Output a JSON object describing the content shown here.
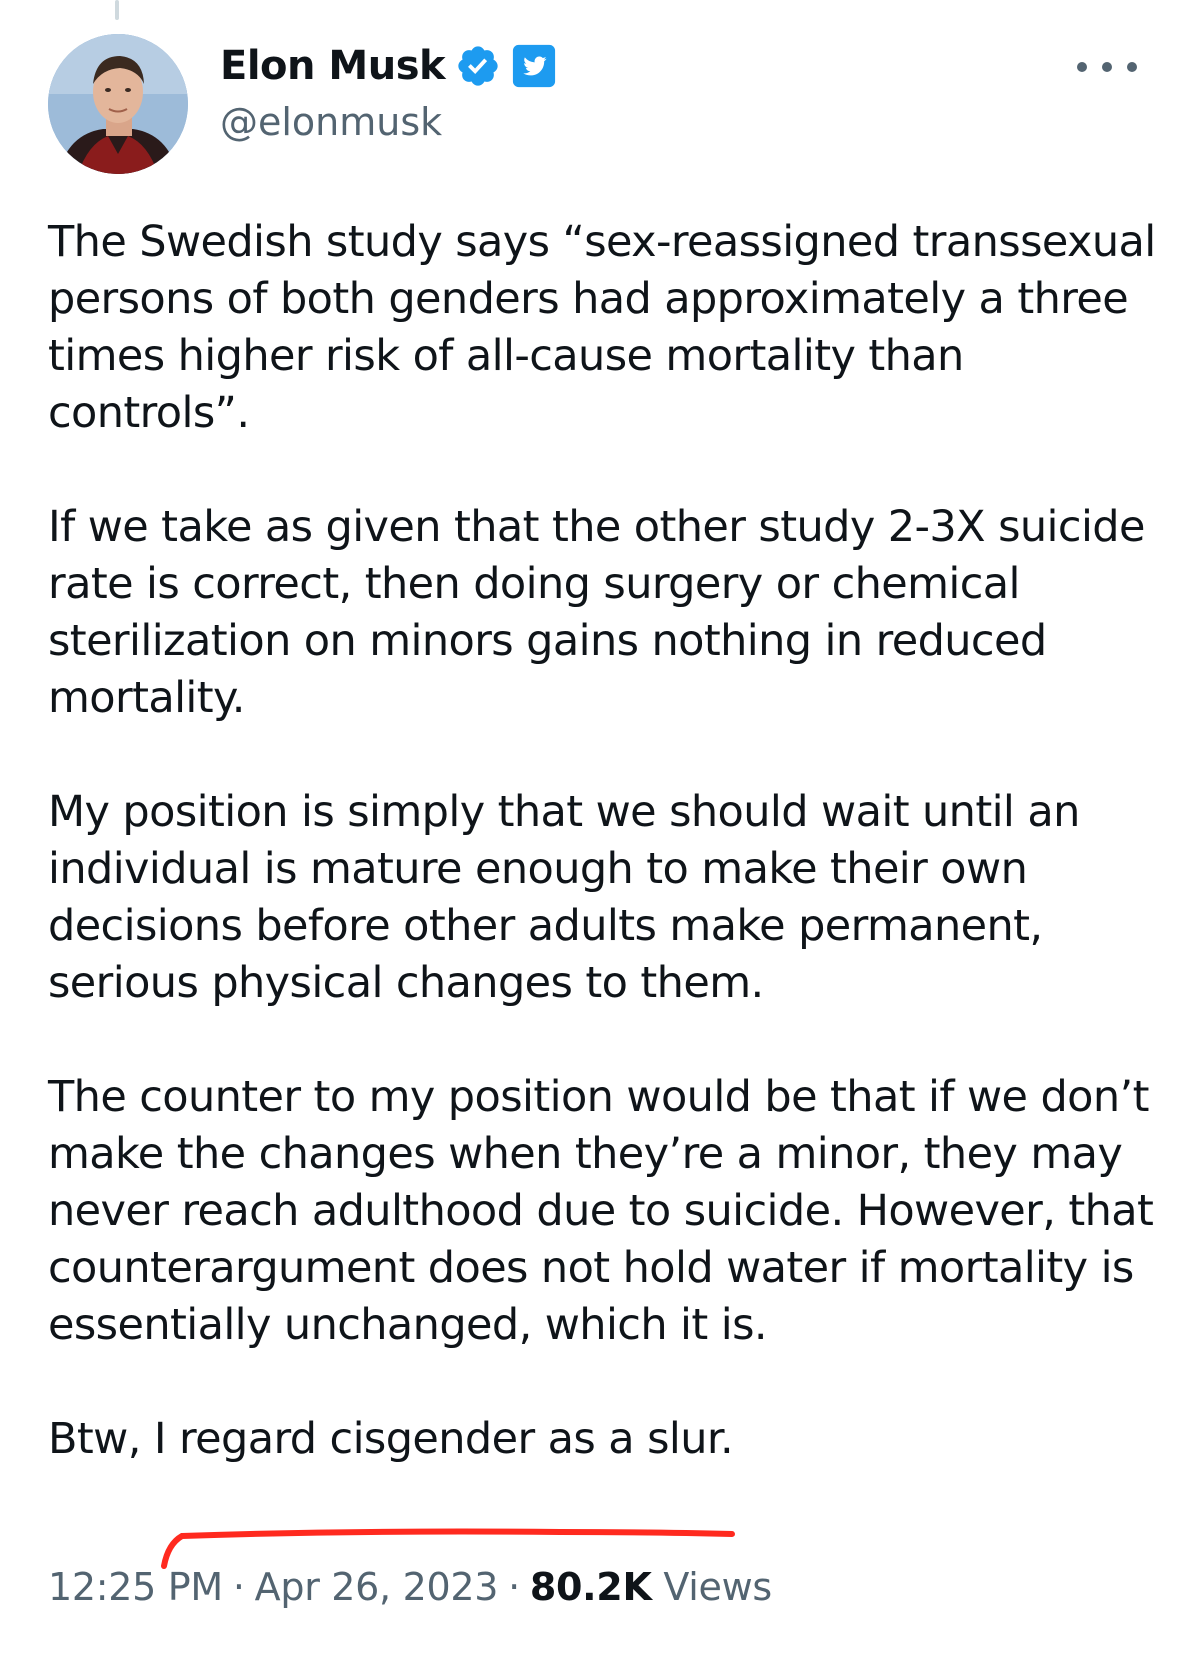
{
  "tweet": {
    "author": {
      "display_name": "Elon Musk",
      "handle": "@elonmusk",
      "verified_icon": "verified-badge-icon",
      "affiliate_icon": "twitter-bird-icon"
    },
    "paragraphs": [
      "The Swedish study says “sex-reassigned transsexual persons of both genders had approximately a three times higher risk of all-cause mortality than controls”.",
      "If we take as given that the other study 2-3X suicide rate is correct, then doing surgery or chemical sterilization on minors gains nothing in reduced mortality.",
      "My position is simply that we should wait until an individual is mature enough to make their own decisions before other adults make permanent, serious physical changes to them.",
      "The counter to my position would be that if we don’t make the changes when they’re a minor, they may never reach adulthood due to suicide. However, that counterargument does not hold water if mortality is essentially unchanged, which it is.",
      "Btw, I regard cisgender as a slur."
    ],
    "time": "12:25 PM",
    "separator": "·",
    "date": "Apr 26, 2023",
    "views_count": "80.2K",
    "views_label": "Views"
  },
  "colors": {
    "text": "#0f1419",
    "secondary": "#536471",
    "verified_blue": "#1d9bf0",
    "annotation_red": "#ff2a1f"
  }
}
